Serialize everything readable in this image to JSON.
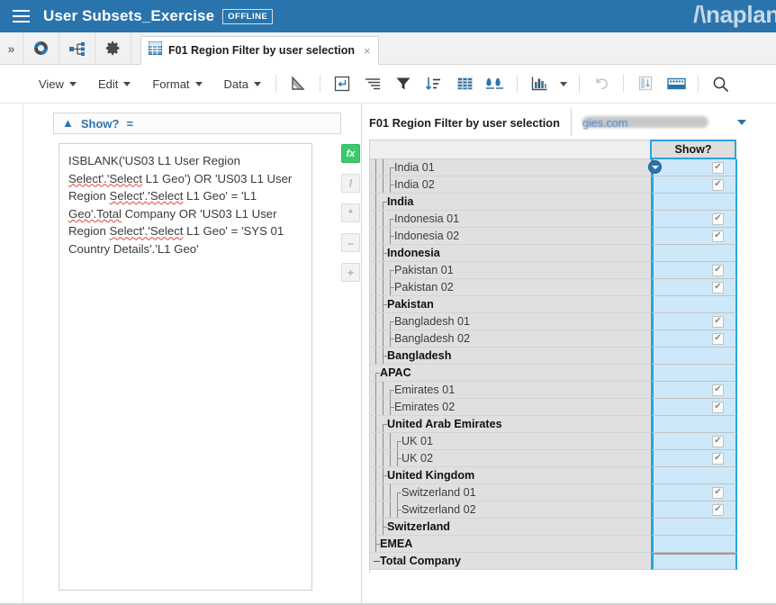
{
  "appbar": {
    "menu_icon": "hamburger-icon",
    "title": "User Subsets_Exercise",
    "status_badge": "OFFLINE",
    "brand": "/\\naplan"
  },
  "tabstrip": {
    "expand_icon": "chevron-double-right-icon",
    "icons": [
      {
        "name": "dashboard-icon"
      },
      {
        "name": "hierarchy-icon"
      },
      {
        "name": "gear-icon"
      }
    ],
    "tab": {
      "icon": "grid-icon",
      "label": "F01 Region Filter by user selection",
      "close": "×"
    }
  },
  "toolbar": {
    "menus": [
      {
        "label": "View"
      },
      {
        "label": "Edit"
      },
      {
        "label": "Format"
      },
      {
        "label": "Data"
      }
    ],
    "tools": [
      {
        "name": "select-cursor-icon"
      },
      {
        "name": "insert-line-break-icon"
      },
      {
        "name": "align-text-icon"
      },
      {
        "name": "filter-icon"
      },
      {
        "name": "sort-icon"
      },
      {
        "name": "show-all-icon"
      },
      {
        "name": "hide-icon"
      },
      {
        "name": "chart-icon"
      },
      {
        "name": "chart-dropdown-caret"
      },
      {
        "name": "undo-icon"
      },
      {
        "name": "pivot-icon"
      },
      {
        "name": "keyboard-icon"
      },
      {
        "name": "search-icon"
      }
    ]
  },
  "formula_panel": {
    "line_bar": {
      "collapse_icon": "chevron-double-up-icon",
      "label": "Show?",
      "equals": "="
    },
    "formula_segments": [
      {
        "text": "ISBLANK('US03 L1 User Region ",
        "misspelled": false
      },
      {
        "text": "Select'.'Select",
        "misspelled": true
      },
      {
        "text": " L1 Geo') OR 'US03 L1 User Region ",
        "misspelled": false
      },
      {
        "text": "Select'.'Select",
        "misspelled": true
      },
      {
        "text": " L1 Geo' = 'L1 ",
        "misspelled": false
      },
      {
        "text": "Geo'.Total",
        "misspelled": true
      },
      {
        "text": " Company OR 'US03 L1 User Region ",
        "misspelled": false
      },
      {
        "text": "Select'.'Select",
        "misspelled": true
      },
      {
        "text": " L1 Geo' = 'SYS 01 Country Details'.'L1 Geo'",
        "misspelled": false
      }
    ],
    "operators": [
      {
        "name": "fx-button",
        "label": "fx",
        "style": "fx"
      },
      {
        "name": "divide-button",
        "label": "/",
        "style": "dim"
      },
      {
        "name": "multiply-button",
        "label": "*",
        "style": "dim"
      },
      {
        "name": "minus-button",
        "label": "–",
        "style": "dim"
      },
      {
        "name": "plus-button",
        "label": "+",
        "style": "dim"
      }
    ]
  },
  "grid": {
    "title": "F01 Region Filter by user selection",
    "user_chip": {
      "text": "gies.com",
      "redacted": true,
      "caret": "dropdown-caret"
    },
    "column_header_blank": "",
    "column_header": "Show?",
    "check_glyph": "✔",
    "rows": [
      {
        "label": "India 01",
        "level": 2,
        "agg": false,
        "checked": true,
        "guide": "first"
      },
      {
        "label": "India 02",
        "level": 2,
        "agg": false,
        "checked": true,
        "guide": "mid"
      },
      {
        "label": "India",
        "level": 1,
        "agg": true,
        "checked": false,
        "guide": "first"
      },
      {
        "label": "Indonesia 01",
        "level": 2,
        "agg": false,
        "checked": true,
        "guide": "first"
      },
      {
        "label": "Indonesia 02",
        "level": 2,
        "agg": false,
        "checked": true,
        "guide": "mid"
      },
      {
        "label": "Indonesia",
        "level": 1,
        "agg": true,
        "checked": false,
        "guide": "mid"
      },
      {
        "label": "Pakistan 01",
        "level": 2,
        "agg": false,
        "checked": true,
        "guide": "first"
      },
      {
        "label": "Pakistan 02",
        "level": 2,
        "agg": false,
        "checked": true,
        "guide": "mid"
      },
      {
        "label": "Pakistan",
        "level": 1,
        "agg": true,
        "checked": false,
        "guide": "mid"
      },
      {
        "label": "Bangladesh 01",
        "level": 2,
        "agg": false,
        "checked": true,
        "guide": "first"
      },
      {
        "label": "Bangladesh 02",
        "level": 2,
        "agg": false,
        "checked": true,
        "guide": "mid"
      },
      {
        "label": "Bangladesh",
        "level": 1,
        "agg": true,
        "checked": false,
        "guide": "mid"
      },
      {
        "label": "APAC",
        "level": 0,
        "agg": true,
        "checked": false,
        "guide": "first"
      },
      {
        "label": "Emirates 01",
        "level": 2,
        "agg": false,
        "checked": true,
        "guide": "first"
      },
      {
        "label": "Emirates 02",
        "level": 2,
        "agg": false,
        "checked": true,
        "guide": "mid"
      },
      {
        "label": "United Arab Emirates",
        "level": 1,
        "agg": true,
        "checked": false,
        "guide": "first"
      },
      {
        "label": "UK 01",
        "level": 3,
        "agg": false,
        "checked": true,
        "guide": "first"
      },
      {
        "label": "UK 02",
        "level": 3,
        "agg": false,
        "checked": true,
        "guide": "mid"
      },
      {
        "label": "United Kingdom",
        "level": 1,
        "agg": true,
        "checked": false,
        "guide": "mid"
      },
      {
        "label": "Switzerland 01",
        "level": 3,
        "agg": false,
        "checked": true,
        "guide": "first"
      },
      {
        "label": "Switzerland 02",
        "level": 3,
        "agg": false,
        "checked": true,
        "guide": "mid"
      },
      {
        "label": "Switzerland",
        "level": 1,
        "agg": true,
        "checked": false,
        "guide": "mid"
      },
      {
        "label": "EMEA",
        "level": 0,
        "agg": true,
        "checked": false,
        "guide": "mid"
      },
      {
        "label": "Total Company",
        "level": -1,
        "agg": true,
        "checked": false,
        "guide": "dash"
      }
    ]
  },
  "colors": {
    "appbar": "#2a74ad",
    "accent": "#2aa3e0",
    "value_cell": "#cde8f8",
    "label_cell": "#e0e0e0",
    "fx_green": "#3cc86c"
  }
}
